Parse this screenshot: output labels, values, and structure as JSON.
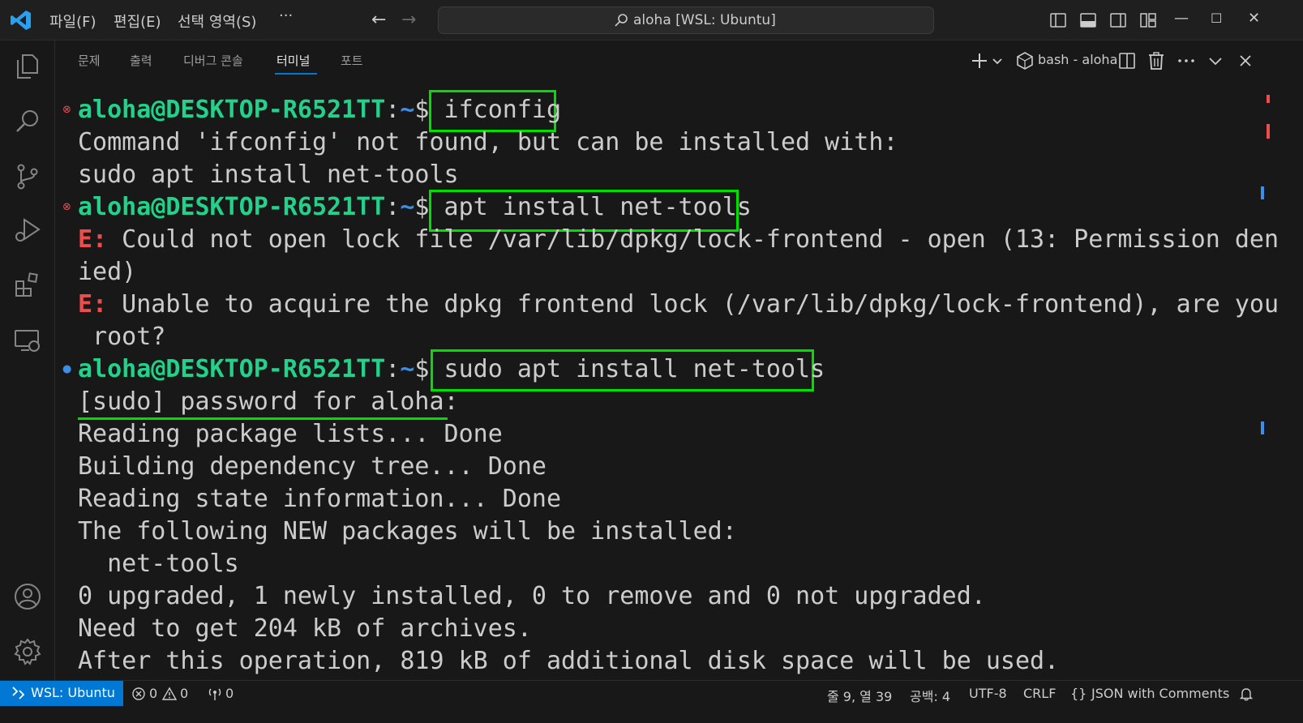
{
  "menu": [
    "파일(F)",
    "편집(E)",
    "선택 영역(S)",
    "···"
  ],
  "command_center": {
    "text": "aloha [WSL: Ubuntu]",
    "icon": "search-icon"
  },
  "panel": {
    "tabs": [
      "문제",
      "출력",
      "디버그 콘솔",
      "터미널",
      "포트"
    ],
    "active_tab": "터미널",
    "terminal_name": "bash - aloha"
  },
  "terminal": {
    "prompt_user": "aloha@DESKTOP-R6521TT",
    "prompt_colon": ":",
    "prompt_path": "~",
    "prompt_dollar": "$ ",
    "cmd1": "ifconfig",
    "line2": "Command 'ifconfig' not found, but can be installed with:",
    "line3": "sudo apt install net-tools",
    "cmd2": "apt install net-tools",
    "err_prefix": "E:",
    "line5": " Could not open lock file /var/lib/dpkg/lock-frontend - open (13: Permission den",
    "line6": "ied)",
    "line7": " Unable to acquire the dpkg frontend lock (/var/lib/dpkg/lock-frontend), are you",
    "line8": " root?",
    "cmd3": "sudo apt install net-tools",
    "line10": "[sudo] password for aloha:",
    "line11": "Reading package lists... Done",
    "line12": "Building dependency tree... Done",
    "line13": "Reading state information... Done",
    "line14": "The following NEW packages will be installed:",
    "line15": "  net-tools",
    "line16": "0 upgraded, 1 newly installed, 0 to remove and 0 not upgraded.",
    "line17": "Need to get 204 kB of archives.",
    "line18": "After this operation, 819 kB of additional disk space will be used."
  },
  "status": {
    "remote": "WSL: Ubuntu",
    "errors": "0",
    "warnings": "0",
    "ports": "0",
    "position": "줄 9, 열 39",
    "spaces": "공백: 4",
    "encoding": "UTF-8",
    "eol": "CRLF",
    "language_braces": "{}",
    "language": "JSON with Comments"
  },
  "colors": {
    "accent": "#0078d4",
    "highlight_box": "#00e000",
    "prompt_green": "#23d18b",
    "prompt_blue": "#3b8eea",
    "error_red": "#f14c4c"
  }
}
